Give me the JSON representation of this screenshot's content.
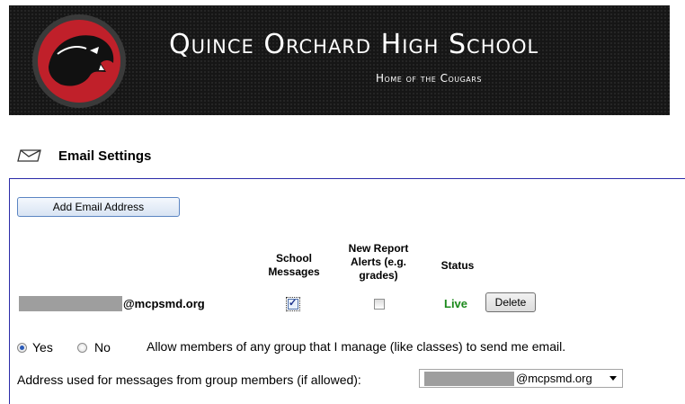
{
  "header": {
    "school_name": "Quince Orchard High School",
    "tagline": "Home of the Cougars",
    "logo": "cougar-logo"
  },
  "section": {
    "icon": "envelope-icon",
    "title": "Email Settings"
  },
  "panel": {
    "add_button_label": "Add Email Address",
    "columns": {
      "school_messages": "School Messages",
      "new_report_alerts": "New Report Alerts (e.g. grades)",
      "status": "Status"
    },
    "email_row": {
      "address_suffix": "@mcpsmd.org",
      "school_messages_checked": true,
      "report_alerts_checked": false,
      "status": "Live",
      "delete_label": "Delete"
    },
    "group_permission": {
      "yes_label": "Yes",
      "no_label": "No",
      "selected": "Yes",
      "description": "Allow members of any group that I manage (like classes) to send me email."
    },
    "address_for_groups": {
      "label": "Address used for messages from group members (if allowed):",
      "selected_suffix": "@mcpsmd.org"
    }
  },
  "colors": {
    "status_live": "#1c8a1c",
    "panel_border": "#2b2ba8",
    "logo_red": "#c0202a"
  }
}
